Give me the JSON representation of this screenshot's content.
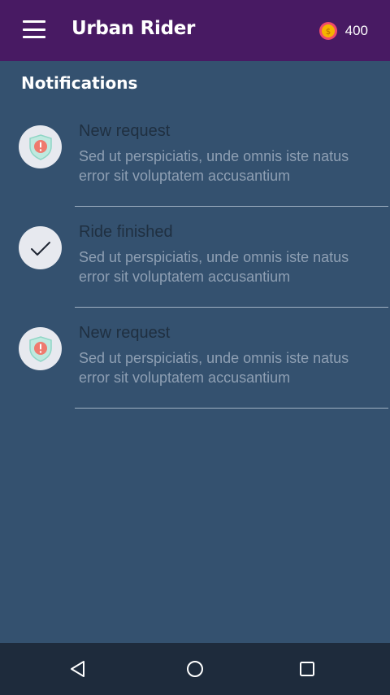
{
  "app": {
    "title": "Urban Rider",
    "coin_balance": "400"
  },
  "section": {
    "title": "Notifications"
  },
  "notifications": [
    {
      "title": "New request",
      "body": "Sed ut perspiciatis, unde omnis iste natus error sit voluptatem accusantium",
      "icon": "shield-alert-icon"
    },
    {
      "title": "Ride finished",
      "body": "Sed ut perspiciatis, unde omnis iste natus error sit voluptatem accusantium",
      "icon": "checkmark-icon"
    },
    {
      "title": "New request",
      "body": "Sed ut perspiciatis, unde omnis iste natus error sit voluptatem accusantium",
      "icon": "shield-alert-icon"
    }
  ],
  "icons": {
    "menu": "hamburger-menu-icon",
    "coin": "coin-icon",
    "nav_back": "back-triangle-icon",
    "nav_home": "home-circle-icon",
    "nav_recent": "recent-apps-square-icon"
  },
  "colors": {
    "topbar": "#481a63",
    "background": "#34516f",
    "navbar": "#1e2b3c",
    "shield_fill": "#bfe9df",
    "alert_red": "#ef7a6e",
    "coin": "#f5b400"
  }
}
